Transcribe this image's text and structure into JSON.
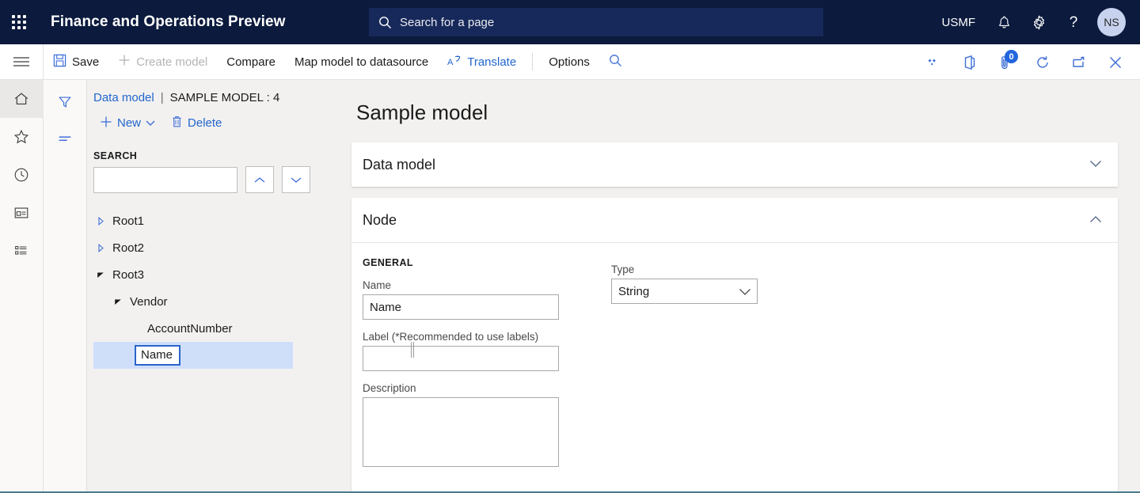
{
  "topbar": {
    "waffle_icon": "app-launcher-icon",
    "title": "Finance and Operations Preview",
    "search": {
      "placeholder": "Search for a page",
      "icon": "search-icon",
      "value": ""
    },
    "company": "USMF",
    "notifications_icon": "bell-icon",
    "settings_icon": "gear-icon",
    "help_icon": "question-mark-icon",
    "avatar_initials": "NS",
    "background_color": "#0b1a3d",
    "search_background_color": "#17295a"
  },
  "toolbar": {
    "menu_icon": "hamburger-icon",
    "items": [
      {
        "label": "Save",
        "icon": "save-icon",
        "state": "normal"
      },
      {
        "label": "Create model",
        "icon": "plus-icon",
        "state": "disabled"
      },
      {
        "label": "Compare",
        "icon": "",
        "state": "normal"
      },
      {
        "label": "Map model to datasource",
        "icon": "",
        "state": "normal"
      },
      {
        "label": "Translate",
        "icon": "translate-icon",
        "state": "link"
      }
    ],
    "options_label": "Options",
    "options_search_icon": "search-icon",
    "right_icons": [
      {
        "name": "shapes-icon",
        "badge": ""
      },
      {
        "name": "office-app-icon",
        "badge": ""
      },
      {
        "name": "attachment-icon",
        "badge": "0"
      },
      {
        "name": "refresh-icon",
        "badge": ""
      },
      {
        "name": "popout-icon",
        "badge": ""
      },
      {
        "name": "close-icon",
        "badge": ""
      }
    ],
    "badge_color": "#2266dd"
  },
  "navrail": {
    "items": [
      {
        "name": "home-icon",
        "active": true
      },
      {
        "name": "star-icon",
        "active": false
      },
      {
        "name": "clock-icon",
        "active": false
      },
      {
        "name": "workspace-icon",
        "active": false
      },
      {
        "name": "list-icon",
        "active": false
      }
    ]
  },
  "filterrail": {
    "items": [
      {
        "name": "filter-icon"
      },
      {
        "name": "lines-icon"
      }
    ]
  },
  "leftpane": {
    "breadcrumb": {
      "link": "Data model",
      "separator": "|",
      "current": "SAMPLE MODEL : 4"
    },
    "commands": {
      "new_label": "New",
      "new_icon": "plus-icon",
      "new_chevron": "chevron-down-icon",
      "delete_label": "Delete",
      "delete_icon": "trash-icon"
    },
    "search": {
      "label": "SEARCH",
      "value": "",
      "placeholder": "",
      "prev_icon": "chevron-up-icon",
      "next_icon": "chevron-down-icon"
    },
    "tree": [
      {
        "label": "Root1",
        "depth": 0,
        "twisty": "collapsed",
        "selected": false,
        "editing": false
      },
      {
        "label": "Root2",
        "depth": 0,
        "twisty": "collapsed",
        "selected": false,
        "editing": false
      },
      {
        "label": "Root3",
        "depth": 0,
        "twisty": "expanded",
        "selected": false,
        "editing": false
      },
      {
        "label": "Vendor",
        "depth": 1,
        "twisty": "expanded",
        "selected": false,
        "editing": false
      },
      {
        "label": "AccountNumber",
        "depth": 2,
        "twisty": "none",
        "selected": false,
        "editing": false
      },
      {
        "label": "Name",
        "depth": 2,
        "twisty": "none",
        "selected": true,
        "editing": true
      }
    ],
    "selection_color": "#cfdffa",
    "splitter_name": "pane-splitter"
  },
  "content": {
    "page_title": "Sample model",
    "sections": [
      {
        "title": "Data model",
        "expanded": false,
        "chevron": "chevron-down-icon"
      },
      {
        "title": "Node",
        "expanded": true,
        "chevron": "chevron-up-icon"
      }
    ],
    "node_form": {
      "group_title": "GENERAL",
      "name": {
        "label": "Name",
        "value": "Name",
        "placeholder": ""
      },
      "label": {
        "label": "Label (*Recommended to use labels)",
        "value": "",
        "placeholder": ""
      },
      "description": {
        "label": "Description",
        "value": "",
        "placeholder": ""
      },
      "type": {
        "label": "Type",
        "value": "String",
        "chevron": "chevron-down-icon",
        "options": [
          "String"
        ]
      }
    }
  }
}
